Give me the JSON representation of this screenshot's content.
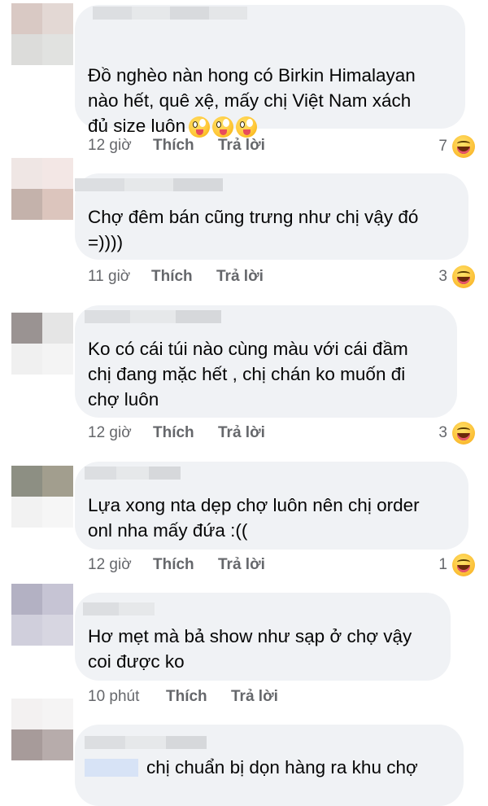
{
  "comments": [
    {
      "text": "Đồ nghèo nàn hong có Birkin Himalayan\nnào hết, quê xệ, mấy chị Việt Nam xách\nđủ size luôn",
      "emojis": [
        "zany-face",
        "zany-face",
        "zany-face"
      ],
      "time": "12 giờ",
      "like": "Thích",
      "reply": "Trả lời",
      "reactions": "7",
      "reaction_icon": "haha-icon"
    },
    {
      "text": "Chợ đêm bán cũng trưng như chị vậy đó\n=))))",
      "time": "11 giờ",
      "like": "Thích",
      "reply": "Trả lời",
      "reactions": "3",
      "reaction_icon": "haha-icon"
    },
    {
      "text": "Ko có cái túi nào cùng màu với cái đầm\nchị đang mặc hết , chị chán ko muốn đi\nchợ luôn",
      "time": "12 giờ",
      "like": "Thích",
      "reply": "Trả lời",
      "reactions": "3",
      "reaction_icon": "haha-icon"
    },
    {
      "text": "Lựa xong nta dẹp chợ luôn nên chị order\nonl nha mấy đứa :((",
      "time": "12 giờ",
      "like": "Thích",
      "reply": "Trả lời",
      "reactions": "1",
      "reaction_icon": "haha-icon"
    },
    {
      "text": "Hơ mẹt mà bả show như sạp ở chợ vậy\ncoi được ko",
      "time": "10 phút",
      "like": "Thích",
      "reply": "Trả lời"
    },
    {
      "text": "chị chuẩn bị dọn hàng ra khu chợ"
    }
  ],
  "colors": {
    "bubble": "#f0f2f5",
    "meta_text": "#65676b",
    "body_text": "#050505"
  }
}
